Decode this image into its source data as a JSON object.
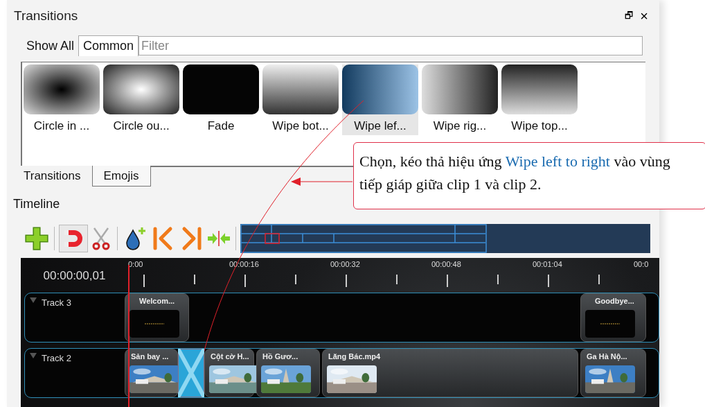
{
  "panel": {
    "title": "Transitions",
    "float_button": "🗗",
    "close_button": "×"
  },
  "filter_tabs": [
    {
      "label": "Show All",
      "selected": false
    },
    {
      "label": "Common",
      "selected": true
    }
  ],
  "filter": {
    "placeholder": "Filter"
  },
  "transitions": [
    {
      "label": "Circle in ...",
      "selected": false
    },
    {
      "label": "Circle ou...",
      "selected": false
    },
    {
      "label": "Fade",
      "selected": false
    },
    {
      "label": "Wipe bot...",
      "selected": false
    },
    {
      "label": "Wipe lef...",
      "selected": true
    },
    {
      "label": "Wipe rig...",
      "selected": false
    },
    {
      "label": "Wipe top...",
      "selected": false
    }
  ],
  "bottom_tabs": [
    {
      "label": "Transitions",
      "selected": true
    },
    {
      "label": "Emojis",
      "selected": false
    }
  ],
  "timeline": {
    "title": "Timeline",
    "snapping": true,
    "timecode": "00:00:00,01",
    "ruler": [
      "0:00",
      "00:00:16",
      "00:00:32",
      "00:00:48",
      "00:01:04",
      "00:0"
    ],
    "tracks": [
      {
        "name": "Track 3",
        "clips": [
          {
            "title": "Welcom...",
            "kind": "title"
          },
          {
            "title": "Goodbye...",
            "kind": "title"
          }
        ]
      },
      {
        "name": "Track 2",
        "clips": [
          {
            "title": "Sản bay ...",
            "kind": "video"
          },
          {
            "kind": "transition"
          },
          {
            "title": "Cột cờ H...",
            "kind": "video"
          },
          {
            "title": "Hồ Gươ...",
            "kind": "video"
          },
          {
            "title": "Lăng Bác.mp4",
            "kind": "video"
          },
          {
            "title": "Ga Hà Nộ...",
            "kind": "video"
          }
        ]
      }
    ]
  },
  "callout": {
    "before": "Chọn, kéo thả hiệu ứng ",
    "highlight": "Wipe left to right",
    "after": " vào vùng tiếp giáp giữa clip 1 và clip 2."
  }
}
